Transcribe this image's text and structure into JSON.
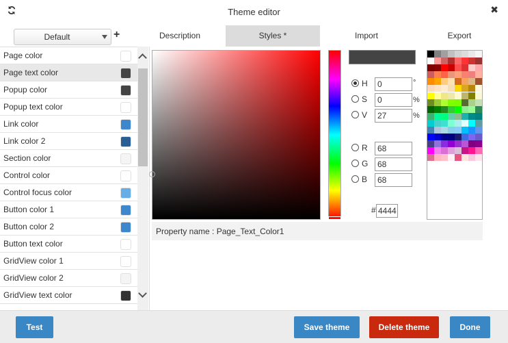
{
  "window": {
    "title": "Theme editor",
    "refresh_icon": "refresh-icon",
    "close_icon": "close-icon",
    "close_glyph": "✖"
  },
  "theme_select": {
    "value": "Default",
    "add_glyph": "+"
  },
  "tabs": [
    {
      "label": "Description",
      "active": false
    },
    {
      "label": "Styles *",
      "active": true
    },
    {
      "label": "Import",
      "active": false
    },
    {
      "label": "Export",
      "active": false
    }
  ],
  "properties": [
    {
      "label": "Page color",
      "color": "#ffffff",
      "selected": false
    },
    {
      "label": "Page text color",
      "color": "#444444",
      "selected": true
    },
    {
      "label": "Popup color",
      "color": "#444444",
      "selected": false
    },
    {
      "label": "Popup text color",
      "color": "#ffffff",
      "selected": false
    },
    {
      "label": "Link color",
      "color": "#3f87cc",
      "selected": false
    },
    {
      "label": "Link color 2",
      "color": "#2a5f95",
      "selected": false
    },
    {
      "label": "Section color",
      "color": "#f4f4f4",
      "selected": false
    },
    {
      "label": "Control color",
      "color": "#ffffff",
      "selected": false
    },
    {
      "label": "Control focus color",
      "color": "#67aee6",
      "selected": false
    },
    {
      "label": "Button color 1",
      "color": "#3f87cc",
      "selected": false
    },
    {
      "label": "Button color 2",
      "color": "#3f87cc",
      "selected": false
    },
    {
      "label": "Button text color",
      "color": "#ffffff",
      "selected": false
    },
    {
      "label": "GridView color 1",
      "color": "#ffffff",
      "selected": false
    },
    {
      "label": "GridView color 2",
      "color": "#f4f4f4",
      "selected": false
    },
    {
      "label": "GridView text color",
      "color": "#333333",
      "selected": false
    }
  ],
  "picker": {
    "preview_color": "#444444",
    "h": {
      "label": "H",
      "value": "0",
      "unit": "°",
      "checked": true
    },
    "s": {
      "label": "S",
      "value": "0",
      "unit": "%",
      "checked": false
    },
    "v": {
      "label": "V",
      "value": "27",
      "unit": "%",
      "checked": false
    },
    "r": {
      "label": "R",
      "value": "68",
      "checked": false
    },
    "g": {
      "label": "G",
      "value": "68",
      "checked": false
    },
    "b": {
      "label": "B",
      "value": "68",
      "checked": false
    },
    "hash": "#",
    "hex": "4444"
  },
  "palette": [
    "#000000",
    "#808080",
    "#a0a0a0",
    "#c0c0c0",
    "#d3d3d3",
    "#dcdcdc",
    "#e8e8e8",
    "#f5f5f5",
    "#ffffff",
    "#ff9999",
    "#cc6666",
    "#b03030",
    "#ff6666",
    "#ff3333",
    "#cc3333",
    "#993333",
    "#800000",
    "#8b0000",
    "#ff0000",
    "#cc0000",
    "#ff5050",
    "#e03030",
    "#ffcccc",
    "#ffaaaa",
    "#cd5c5c",
    "#ff7f50",
    "#ff6347",
    "#e9967a",
    "#ffa07a",
    "#fa8072",
    "#f08080",
    "#ffb0a0",
    "#ff8c00",
    "#ffa500",
    "#ffcc80",
    "#ffe0b0",
    "#d2691e",
    "#f4a460",
    "#deb887",
    "#a0522d",
    "#ffdab9",
    "#ffe4c4",
    "#ffebcd",
    "#f5deb3",
    "#ffd700",
    "#daa520",
    "#b8860b",
    "#fff8dc",
    "#ffff00",
    "#ffff99",
    "#f0e68c",
    "#eee8aa",
    "#fffacd",
    "#bdb76b",
    "#808000",
    "#fafad2",
    "#6b8e23",
    "#9acd32",
    "#adff2f",
    "#7fff00",
    "#7cfc00",
    "#556b2f",
    "#a9d18e",
    "#c5e0b4",
    "#006400",
    "#008000",
    "#228b22",
    "#32cd32",
    "#00ff00",
    "#90ee90",
    "#98fb98",
    "#2e8b57",
    "#3cb371",
    "#00fa9a",
    "#00ff7f",
    "#66cdaa",
    "#8fbc8f",
    "#20b2aa",
    "#008b8b",
    "#008080",
    "#00ced1",
    "#48d1cc",
    "#40e0d0",
    "#7fffd4",
    "#afeeee",
    "#e0ffff",
    "#00ffff",
    "#5f9ea0",
    "#4682b4",
    "#b0c4de",
    "#add8e6",
    "#87ceeb",
    "#87cefa",
    "#00bfff",
    "#1e90ff",
    "#6495ed",
    "#0000ff",
    "#0000cd",
    "#00008b",
    "#000080",
    "#191970",
    "#4169e1",
    "#7b68ee",
    "#6a5acd",
    "#483d8b",
    "#9370db",
    "#8a2be2",
    "#9400d3",
    "#9932cc",
    "#ba55d3",
    "#800080",
    "#8b008b",
    "#ff00ff",
    "#ee82ee",
    "#da70d6",
    "#dda0dd",
    "#d8bfd8",
    "#c71585",
    "#ff1493",
    "#ff69b4",
    "#db7093",
    "#ffb6c1",
    "#ffc0cb",
    "#fff0f5",
    "#e75480",
    "#ffe4e1",
    "#f8c8dc",
    "#fce4ec"
  ],
  "property_name": "Property name : Page_Text_Color1",
  "footer": {
    "test": "Test",
    "save": "Save theme",
    "delete": "Delete theme",
    "done": "Done"
  }
}
